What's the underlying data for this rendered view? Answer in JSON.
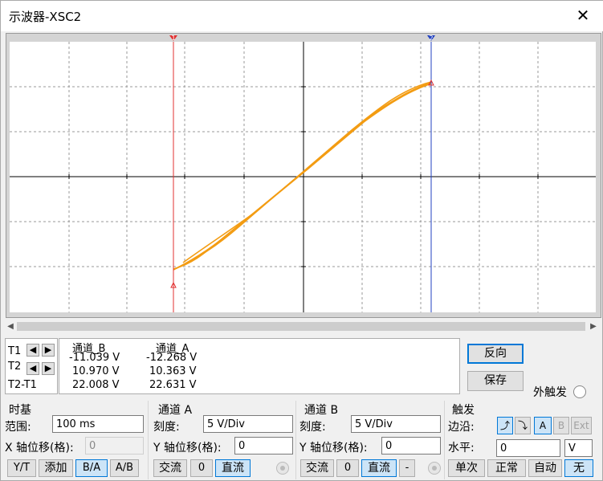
{
  "window": {
    "title": "示波器-XSC2",
    "close_glyph": "✕"
  },
  "markers": {
    "t1": "1",
    "t2": "2"
  },
  "cursors": {
    "t1_label": "T1",
    "t2_label": "T2",
    "t2t1_label": "T2-T1"
  },
  "readout": {
    "col_b_header": "通道_B",
    "col_a_header": "通道_A",
    "rows": [
      {
        "b": "-11.039 V",
        "a": "-12.268 V"
      },
      {
        "b": "10.970 V",
        "a": "10.363 V"
      },
      {
        "b": "22.008 V",
        "a": "22.631 V"
      }
    ]
  },
  "buttons": {
    "reverse": "反向",
    "save": "保存",
    "ext_trigger": "外触发"
  },
  "timebase": {
    "title": "时基",
    "scale_label": "范围:",
    "scale_value": "100 ms",
    "xpos_label": "X 轴位移(格):",
    "xpos_value": "0",
    "modes": [
      "Y/T",
      "添加",
      "B/A",
      "A/B"
    ]
  },
  "channel_a": {
    "title": "通道 A",
    "scale_label": "刻度:",
    "scale_value": "5  V/Div",
    "ypos_label": "Y 轴位移(格):",
    "ypos_value": "0",
    "coupling": [
      "交流",
      "0",
      "直流"
    ]
  },
  "channel_b": {
    "title": "通道 B",
    "scale_label": "刻度:",
    "scale_value": "5  V/Div",
    "ypos_label": "Y 轴位移(格):",
    "ypos_value": "0",
    "coupling": [
      "交流",
      "0",
      "直流",
      "-"
    ]
  },
  "trigger": {
    "title": "触发",
    "edge_label": "边沿:",
    "level_label": "水平:",
    "level_value": "0",
    "level_unit": "V",
    "sources": [
      "A",
      "B",
      "Ext"
    ],
    "modes": [
      "单次",
      "正常",
      "自动",
      "无"
    ]
  },
  "colors": {
    "trace": "#f39c12",
    "cursor1": "#e03030",
    "cursor2": "#2040c0",
    "grid": "#9a9a9a",
    "screen": "#ffffff"
  }
}
